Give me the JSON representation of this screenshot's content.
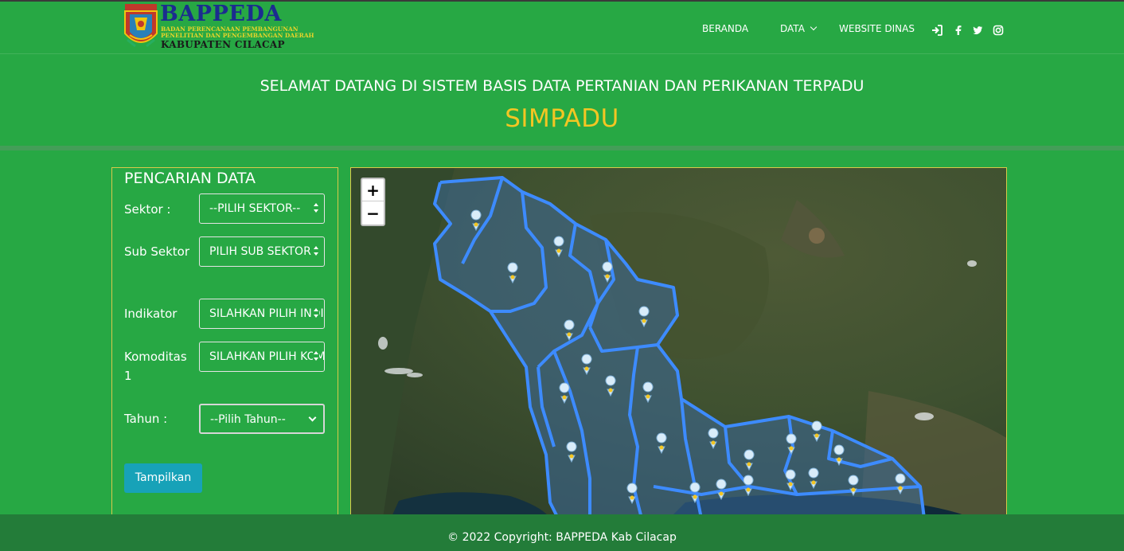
{
  "brand": {
    "title": "BAPPEDA",
    "subtitle_line1": "BADAN PERENCANAAN PEMBANGUNAN",
    "subtitle_line2": "PENELITIAN DAN PENGEMBANGAN DAERAH",
    "region": "KABUPATEN CILACAP",
    "emblem_text": "CILACAP"
  },
  "nav": {
    "home": "BERANDA",
    "data": "DATA",
    "agency_site": "WEBSITE DINAS"
  },
  "icons": [
    "login-icon",
    "facebook-icon",
    "twitter-icon",
    "instagram-icon"
  ],
  "hero": {
    "welcome": "SELAMAT DATANG DI SISTEM BASIS DATA PERTANIAN DAN PERIKANAN TERPADU",
    "app_name": "SIMPADU"
  },
  "search": {
    "title": "PENCARIAN DATA",
    "sector_label": "Sektor :",
    "sector_value": "--PILIH SEKTOR--",
    "subsector_label": "Sub Sektor",
    "subsector_value": "PILIH SUB SEKTOR",
    "indicator_label": "Indikator",
    "indicator_value": "SILAHKAN PILIH INDIKATOR",
    "commodity_label": "Komoditas 1",
    "commodity_value": "SILAHKAN PILIH KOMODITAS",
    "year_label": "Tahun :",
    "year_value": "--Pilih Tahun--",
    "submit": "Tampilkan"
  },
  "map": {
    "zoom_in": "+",
    "zoom_out": "−"
  },
  "footer": {
    "copyright": "© 2022 Copyright: BAPPEDA Kab Cilacap"
  },
  "colors": {
    "background": "#27a844",
    "accent": "#f3c623",
    "footer": "#237c39",
    "button": "#17a2b8",
    "brand_blue": "#1b2c8f",
    "boundary": "#3d8bff"
  }
}
